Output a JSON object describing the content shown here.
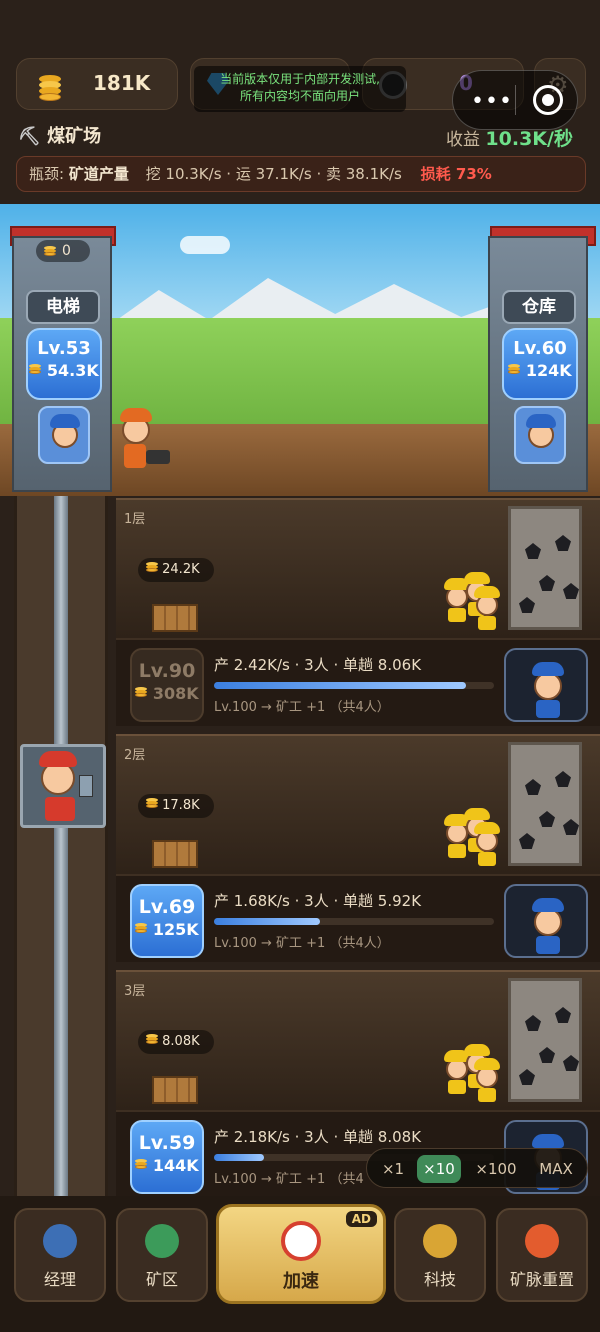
{
  "top": {
    "coins": "181K",
    "notice_line1": "当前版本仅用于内部开发测试,",
    "notice_line2": "所有内容均不面向用户",
    "counter": "0"
  },
  "mine": {
    "name": "煤矿场",
    "income_label": "收益",
    "income_value": "10.3K/秒"
  },
  "bottleneck": {
    "label": "瓶颈:",
    "target": "矿道产量",
    "stats": "挖 10.3K/s · 运 37.1K/s · 卖 38.1K/s",
    "loss": "损耗 73%"
  },
  "elevator_tower": {
    "stored": "0",
    "label": "电梯",
    "level": "Lv.53",
    "cost": "54.3K"
  },
  "warehouse_tower": {
    "label": "仓库",
    "level": "Lv.60",
    "cost": "124K"
  },
  "floors": [
    {
      "label": "1层",
      "stored": "24.2K",
      "level": "Lv.90",
      "cost": "308K",
      "stats": "产 2.42K/s · 3人 · 单趟 8.06K",
      "progress": 0.9,
      "next": "Lv.100 → 矿工 +1 （共4人）"
    },
    {
      "label": "2层",
      "stored": "17.8K",
      "level": "Lv.69",
      "cost": "125K",
      "stats": "产 1.68K/s · 3人 · 单趟 5.92K",
      "progress": 0.38,
      "next": "Lv.100 → 矿工 +1 （共4人）"
    },
    {
      "label": "3层",
      "stored": "8.08K",
      "level": "Lv.59",
      "cost": "144K",
      "stats": "产 2.18K/s · 3人 · 单趟 8.08K",
      "progress": 0.18,
      "next": "Lv.100 → 矿工 +1 （共4"
    }
  ],
  "multiplier": {
    "options": [
      "×1",
      "×10",
      "×100",
      "MAX"
    ],
    "selected": "×10"
  },
  "nav": {
    "manager": "经理",
    "area": "矿区",
    "speed": "加速",
    "ad": "AD",
    "tech": "科技",
    "reset": "矿脉重置"
  },
  "colors": {
    "accent_green": "#3f8a58",
    "loss_red": "#ff5a4d",
    "level_blue": "#2c6fd4",
    "income_green": "#6fe08a"
  }
}
